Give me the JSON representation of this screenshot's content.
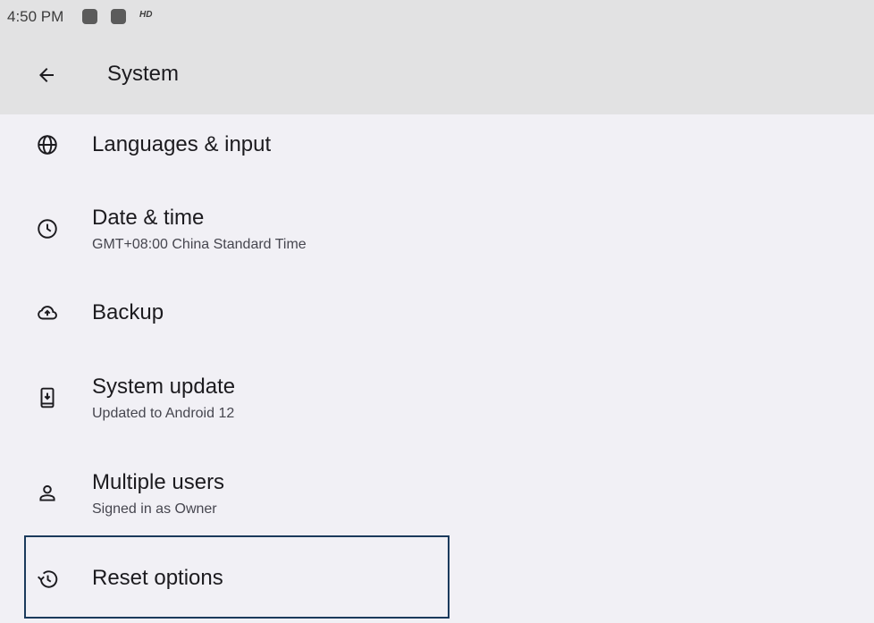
{
  "status_bar": {
    "time": "4:50 PM",
    "badge": "HD"
  },
  "app_bar": {
    "title": "System",
    "back_icon": "arrow-back-icon"
  },
  "items": [
    {
      "title": "Languages & input",
      "subtitle": "",
      "icon": "globe-icon"
    },
    {
      "title": "Date & time",
      "subtitle": "GMT+08:00 China Standard Time",
      "icon": "clock-icon"
    },
    {
      "title": "Backup",
      "subtitle": "",
      "icon": "cloud-upload-icon"
    },
    {
      "title": "System update",
      "subtitle": "Updated to Android 12",
      "icon": "system-update-icon"
    },
    {
      "title": "Multiple users",
      "subtitle": "Signed in as Owner",
      "icon": "person-icon"
    },
    {
      "title": "Reset options",
      "subtitle": "",
      "icon": "restore-icon"
    }
  ],
  "colors": {
    "app_bar_bg": "#e2e2e3",
    "page_bg": "#f1f0f5",
    "highlight": "#1b3a5c"
  }
}
